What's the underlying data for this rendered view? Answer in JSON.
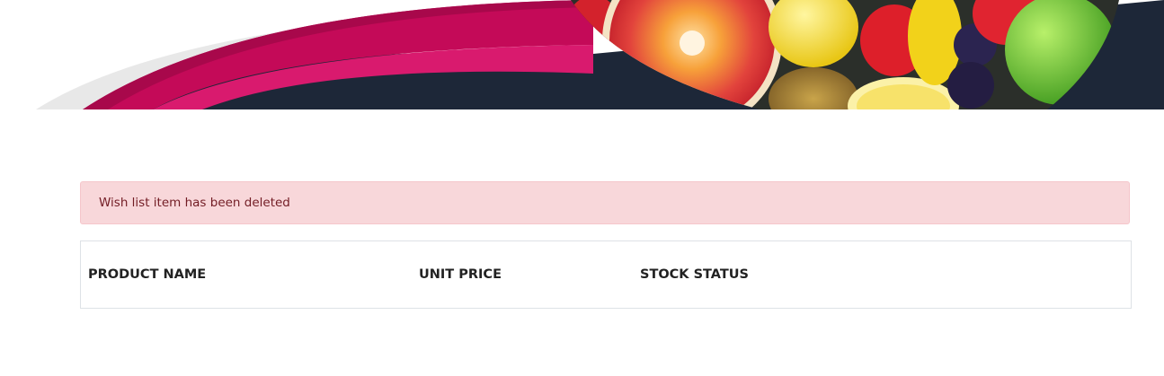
{
  "notification": {
    "message": "Wish list item has been deleted"
  },
  "wishlist_table": {
    "columns": [
      "PRODUCT NAME",
      "UNIT PRICE",
      "STOCK STATUS"
    ]
  },
  "colors": {
    "alert_background": "#f8d7da",
    "alert_text": "#721c24",
    "banner_pink": "#c40a58",
    "banner_dark": "#1d2738"
  },
  "icons": {
    "banner_image": "fruit-banner-image"
  }
}
